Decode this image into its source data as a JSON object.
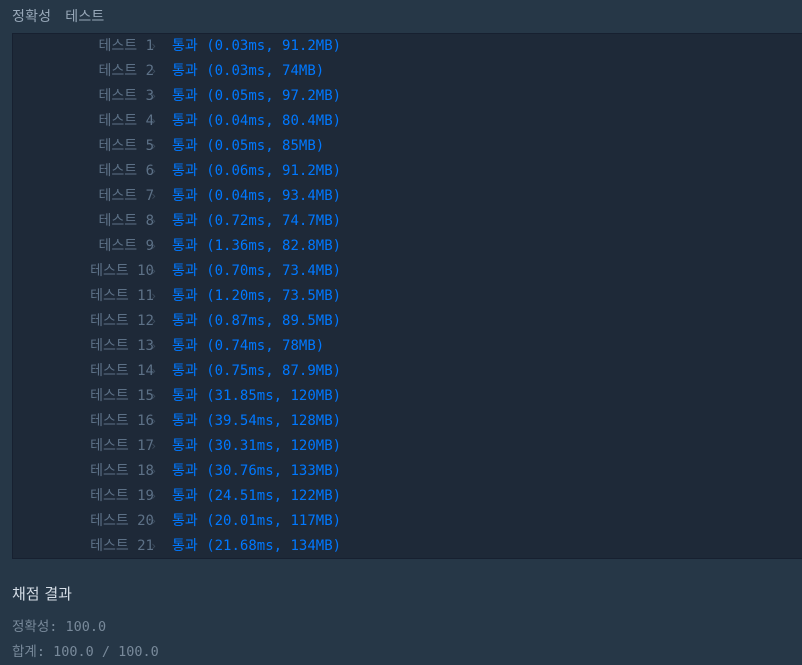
{
  "header": {
    "tab_accuracy": "정확성",
    "tab_test": "테스트"
  },
  "tests": [
    {
      "label": "테스트 1",
      "result": "통과 (0.03ms, 91.2MB)"
    },
    {
      "label": "테스트 2",
      "result": "통과 (0.03ms, 74MB)"
    },
    {
      "label": "테스트 3",
      "result": "통과 (0.05ms, 97.2MB)"
    },
    {
      "label": "테스트 4",
      "result": "통과 (0.04ms, 80.4MB)"
    },
    {
      "label": "테스트 5",
      "result": "통과 (0.05ms, 85MB)"
    },
    {
      "label": "테스트 6",
      "result": "통과 (0.06ms, 91.2MB)"
    },
    {
      "label": "테스트 7",
      "result": "통과 (0.04ms, 93.4MB)"
    },
    {
      "label": "테스트 8",
      "result": "통과 (0.72ms, 74.7MB)"
    },
    {
      "label": "테스트 9",
      "result": "통과 (1.36ms, 82.8MB)"
    },
    {
      "label": "테스트 10",
      "result": "통과 (0.70ms, 73.4MB)"
    },
    {
      "label": "테스트 11",
      "result": "통과 (1.20ms, 73.5MB)"
    },
    {
      "label": "테스트 12",
      "result": "통과 (0.87ms, 89.5MB)"
    },
    {
      "label": "테스트 13",
      "result": "통과 (0.74ms, 78MB)"
    },
    {
      "label": "테스트 14",
      "result": "통과 (0.75ms, 87.9MB)"
    },
    {
      "label": "테스트 15",
      "result": "통과 (31.85ms, 120MB)"
    },
    {
      "label": "테스트 16",
      "result": "통과 (39.54ms, 128MB)"
    },
    {
      "label": "테스트 17",
      "result": "통과 (30.31ms, 120MB)"
    },
    {
      "label": "테스트 18",
      "result": "통과 (30.76ms, 133MB)"
    },
    {
      "label": "테스트 19",
      "result": "통과 (24.51ms, 122MB)"
    },
    {
      "label": "테스트 20",
      "result": "통과 (20.01ms, 117MB)"
    },
    {
      "label": "테스트 21",
      "result": "통과 (21.68ms, 134MB)"
    }
  ],
  "chevron_icon": "chevron-right-icon",
  "summary": {
    "title": "채점 결과",
    "accuracy": "정확성: 100.0",
    "total": "합계: 100.0 / 100.0"
  },
  "colors": {
    "background": "#263747",
    "panel": "#1e2938",
    "pass": "#0078ff",
    "label": "#5d7187"
  }
}
